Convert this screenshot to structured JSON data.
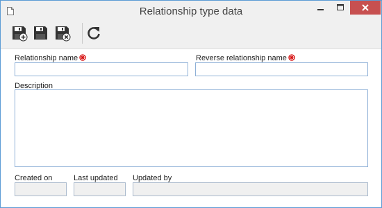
{
  "window": {
    "title": "Relationship type data",
    "icons": [
      "document-icon",
      "minimize-icon",
      "maximize-icon",
      "close-icon"
    ]
  },
  "toolbar": {
    "buttons": [
      {
        "name": "save-and-new-button",
        "icon": "floppy-plus-icon"
      },
      {
        "name": "save-button",
        "icon": "floppy-icon"
      },
      {
        "name": "save-and-exit-button",
        "icon": "floppy-close-icon"
      },
      {
        "name": "refresh-button",
        "icon": "refresh-icon"
      }
    ]
  },
  "form": {
    "relationship_name": {
      "label": "Relationship name",
      "value": "",
      "required": true
    },
    "reverse_relationship_name": {
      "label": "Reverse relationship name",
      "value": "",
      "required": true
    },
    "description": {
      "label": "Description",
      "value": ""
    },
    "created_on": {
      "label": "Created on",
      "value": ""
    },
    "last_updated": {
      "label": "Last updated",
      "value": ""
    },
    "updated_by": {
      "label": "Updated by",
      "value": ""
    }
  },
  "colors": {
    "close_button": "#c75050",
    "required_marker": "#d40000",
    "input_border": "#8fb1d7",
    "readonly_bg": "#f0f0f0"
  }
}
